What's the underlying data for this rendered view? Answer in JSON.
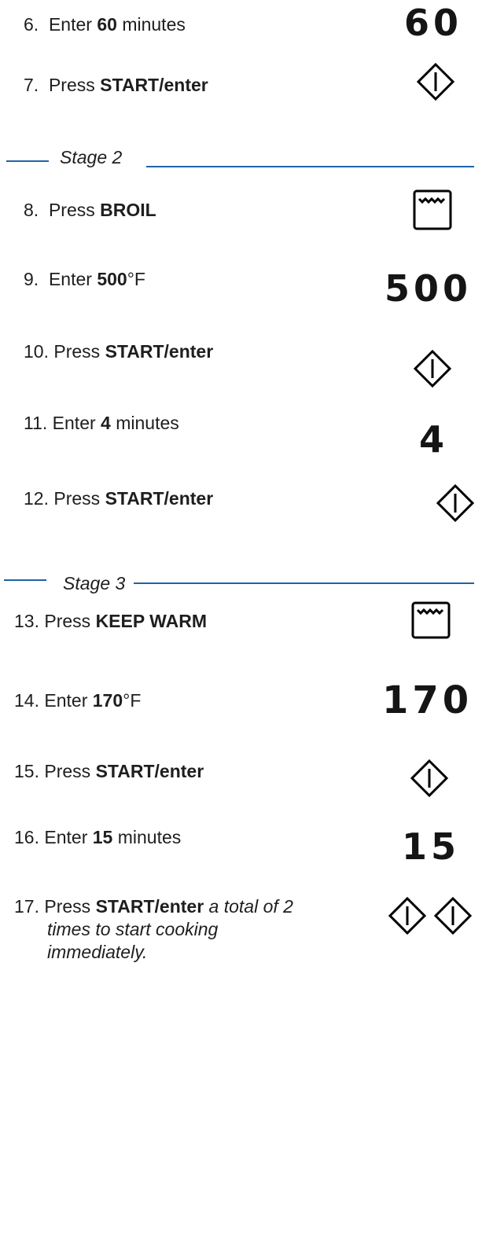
{
  "steps": [
    {
      "num": "6.",
      "pre": "Enter ",
      "bold": "60",
      "post": " minutes"
    },
    {
      "num": "7.",
      "pre": "Press ",
      "bold": "START/enter",
      "post": ""
    },
    {
      "num": "8.",
      "pre": "Press ",
      "bold": "BROIL",
      "post": ""
    },
    {
      "num": "9.",
      "pre": "Enter ",
      "bold": "500",
      "post": "°F"
    },
    {
      "num": "10.",
      "pre": "Press ",
      "bold": "START/enter",
      "post": ""
    },
    {
      "num": "11.",
      "pre": "Enter ",
      "bold": "4",
      "post": " minutes"
    },
    {
      "num": "12.",
      "pre": "Press ",
      "bold": "START/enter",
      "post": ""
    },
    {
      "num": "13.",
      "pre": "Press ",
      "bold": "KEEP WARM",
      "post": ""
    },
    {
      "num": "14.",
      "pre": "Enter ",
      "bold": "170",
      "post": "°F"
    },
    {
      "num": "15.",
      "pre": "Press ",
      "bold": "START/enter",
      "post": ""
    },
    {
      "num": "16.",
      "pre": "Enter ",
      "bold": "15",
      "post": " minutes"
    },
    {
      "num": "17.",
      "pre": "Press ",
      "bold": "START/enter",
      "post": " a total of 2",
      "cont1": "times to start cooking",
      "cont2": "immediately."
    }
  ],
  "stages": {
    "stage2": "Stage 2",
    "stage3": "Stage 3"
  },
  "displays": {
    "d60": "60",
    "d500": "500",
    "d4": "4",
    "d170": "170",
    "d15": "15"
  },
  "icons": {
    "start": "start-enter-diamond-icon",
    "oven": "oven-element-icon"
  },
  "colors": {
    "rule": "#1f63a8",
    "text": "#1e1e1e"
  }
}
